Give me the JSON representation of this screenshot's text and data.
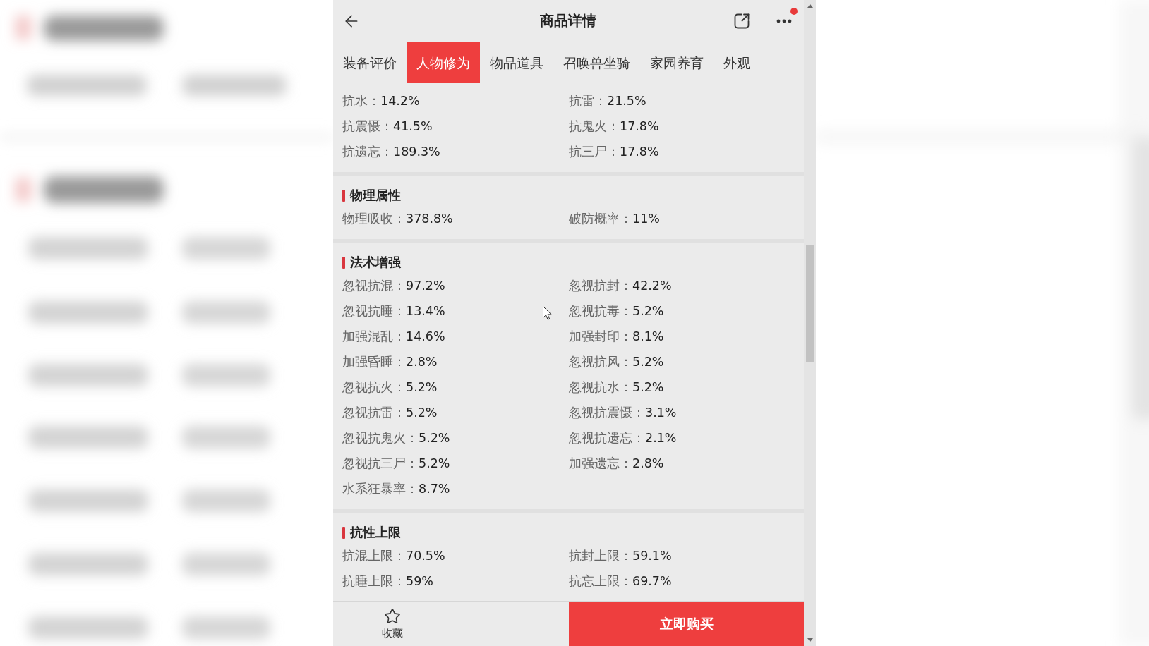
{
  "header": {
    "title": "商品详情",
    "more_badge": true
  },
  "tabs": [
    {
      "label": "装备评价",
      "selected": false
    },
    {
      "label": "人物修为",
      "selected": true
    },
    {
      "label": "物品道具",
      "selected": false
    },
    {
      "label": "召唤兽坐骑",
      "selected": false
    },
    {
      "label": "家园养育",
      "selected": false
    },
    {
      "label": "外观",
      "selected": false
    }
  ],
  "sections": [
    {
      "stats": [
        {
          "label": "抗水：",
          "value": "14.2%"
        },
        {
          "label": "抗雷：",
          "value": "21.5%"
        },
        {
          "label": "抗震慑：",
          "value": "41.5%"
        },
        {
          "label": "抗鬼火：",
          "value": "17.8%"
        },
        {
          "label": "抗遗忘：",
          "value": "189.3%"
        },
        {
          "label": "抗三尸：",
          "value": "17.8%"
        }
      ]
    },
    {
      "title": "物理属性",
      "stats": [
        {
          "label": "物理吸收：",
          "value": "378.8%"
        },
        {
          "label": "破防概率：",
          "value": "11%"
        }
      ]
    },
    {
      "title": "法术增强",
      "stats": [
        {
          "label": "忽视抗混：",
          "value": "97.2%"
        },
        {
          "label": "忽视抗封：",
          "value": "42.2%"
        },
        {
          "label": "忽视抗睡：",
          "value": "13.4%"
        },
        {
          "label": "忽视抗毒：",
          "value": "5.2%"
        },
        {
          "label": "加强混乱：",
          "value": "14.6%"
        },
        {
          "label": "加强封印：",
          "value": "8.1%"
        },
        {
          "label": "加强昏睡：",
          "value": "2.8%"
        },
        {
          "label": "忽视抗风：",
          "value": "5.2%"
        },
        {
          "label": "忽视抗火：",
          "value": "5.2%"
        },
        {
          "label": "忽视抗水：",
          "value": "5.2%"
        },
        {
          "label": "忽视抗雷：",
          "value": "5.2%"
        },
        {
          "label": "忽视抗震慑：",
          "value": "3.1%"
        },
        {
          "label": "忽视抗鬼火：",
          "value": "5.2%"
        },
        {
          "label": "忽视抗遗忘：",
          "value": "2.1%"
        },
        {
          "label": "忽视抗三尸：",
          "value": "5.2%"
        },
        {
          "label": "加强遗忘：",
          "value": "2.8%"
        },
        {
          "label": "水系狂暴率：",
          "value": "8.7%"
        }
      ]
    },
    {
      "title": "抗性上限",
      "stats": [
        {
          "label": "抗混上限：",
          "value": "70.5%"
        },
        {
          "label": "抗封上限：",
          "value": "59.1%"
        },
        {
          "label": "抗睡上限：",
          "value": "59%"
        },
        {
          "label": "抗忘上限：",
          "value": "69.7%"
        }
      ]
    }
  ],
  "bottom_bar": {
    "favorite_label": "收藏",
    "buy_button": "立即购买"
  }
}
